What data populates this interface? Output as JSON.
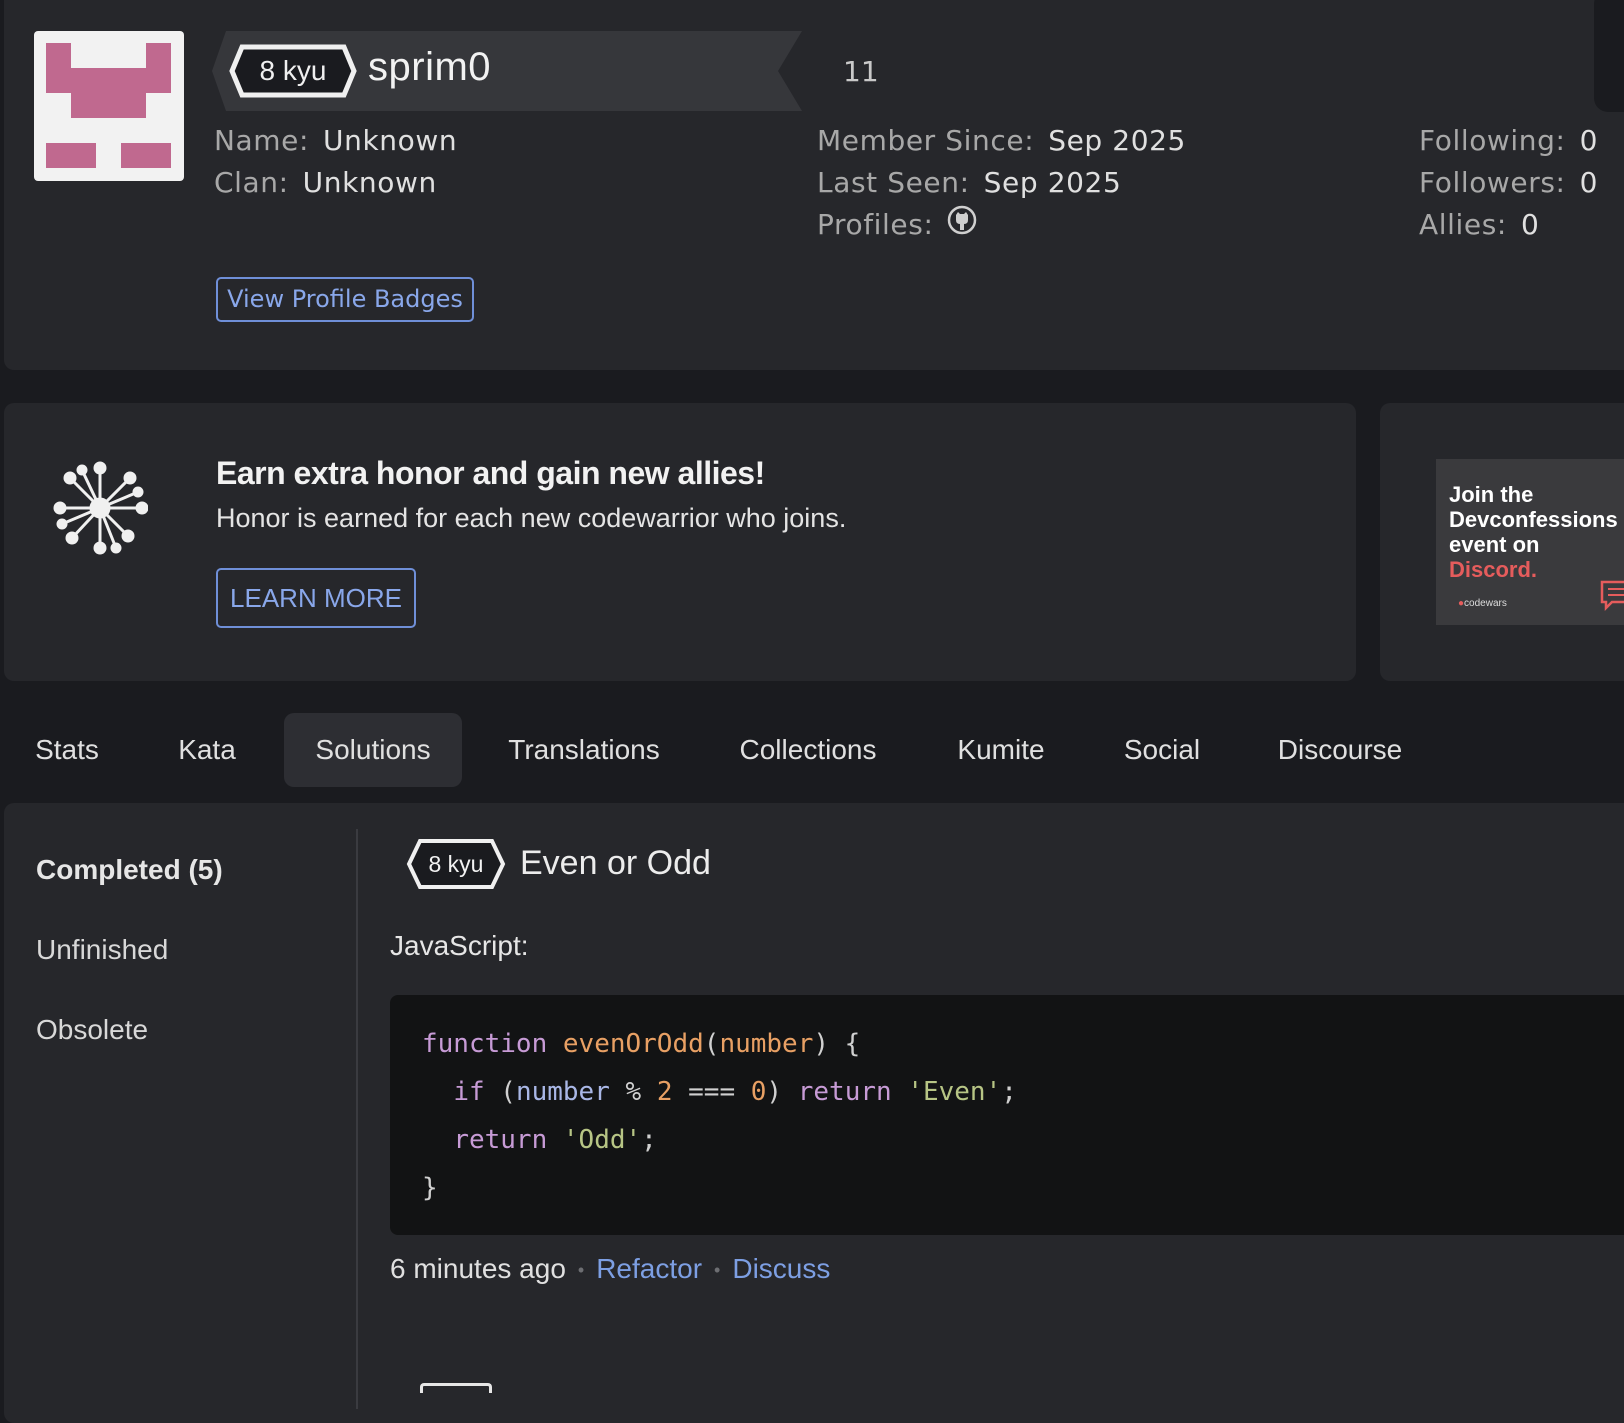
{
  "profile": {
    "rank": "8 kyu",
    "username": "sprim0",
    "honor": "11",
    "name_label": "Name:",
    "name_value": "Unknown",
    "clan_label": "Clan:",
    "clan_value": "Unknown",
    "member_since_label": "Member Since:",
    "member_since_value": "Sep 2025",
    "last_seen_label": "Last Seen:",
    "last_seen_value": "Sep 2025",
    "profiles_label": "Profiles:",
    "profiles_icon": "github-icon",
    "following_label": "Following:",
    "following_value": "0",
    "followers_label": "Followers:",
    "followers_value": "0",
    "allies_label": "Allies:",
    "allies_value": "0",
    "badges_button": "View Profile Badges",
    "avatar_color": "#c0698f"
  },
  "promo": {
    "title": "Earn extra honor and gain new allies!",
    "subtitle": "Honor is earned for each new codewarrior who joins.",
    "button": "LEARN MORE"
  },
  "ad": {
    "line1": "Join the",
    "line2": "Devconfessions",
    "line3": "event on",
    "line4": "Discord.",
    "logo": "codewars",
    "accent": "#e55c5c"
  },
  "tabs": [
    "Stats",
    "Kata",
    "Solutions",
    "Translations",
    "Collections",
    "Kumite",
    "Social",
    "Discourse"
  ],
  "active_tab": "Solutions",
  "sidebar": {
    "completed": "Completed (5)",
    "unfinished": "Unfinished",
    "obsolete": "Obsolete"
  },
  "solution": {
    "rank": "8 kyu",
    "title": "Even or Odd",
    "language": "JavaScript:",
    "code_lines": [
      "function evenOrOdd(number) {",
      "  if (number % 2 === 0) return 'Even';",
      "  return 'Odd';",
      "}"
    ],
    "time": "6 minutes ago",
    "refactor": "Refactor",
    "discuss": "Discuss",
    "separator": "•"
  }
}
